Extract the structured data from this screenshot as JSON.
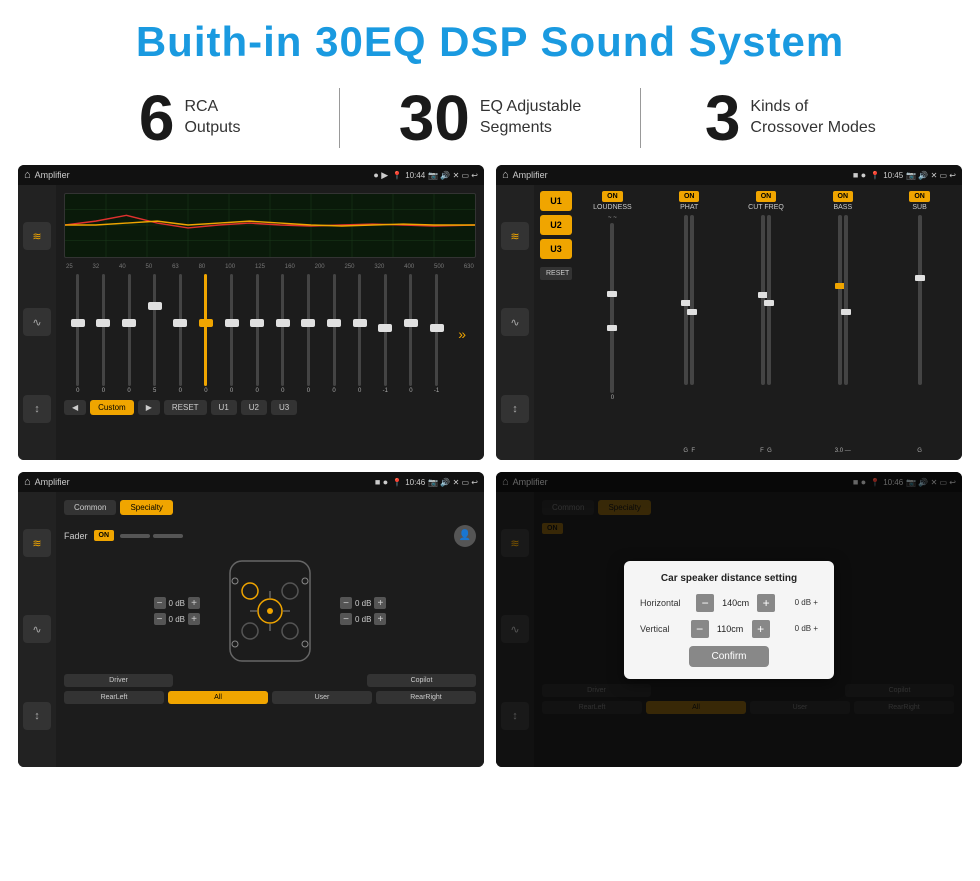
{
  "page": {
    "title": "Buith-in 30EQ DSP Sound System",
    "stats": [
      {
        "number": "6",
        "label_line1": "RCA",
        "label_line2": "Outputs"
      },
      {
        "number": "30",
        "label_line1": "EQ Adjustable",
        "label_line2": "Segments"
      },
      {
        "number": "3",
        "label_line1": "Kinds of",
        "label_line2": "Crossover Modes"
      }
    ]
  },
  "screen_top_left": {
    "title": "Amplifier",
    "time": "10:44",
    "eq_freqs": [
      "25",
      "32",
      "40",
      "50",
      "63",
      "80",
      "100",
      "125",
      "160",
      "200",
      "250",
      "320",
      "400",
      "500",
      "630"
    ],
    "eq_values": [
      "0",
      "0",
      "0",
      "5",
      "0",
      "0",
      "0",
      "0",
      "0",
      "0",
      "0",
      "0",
      "-1",
      "0",
      "-1"
    ],
    "buttons": [
      "Custom",
      "RESET",
      "U1",
      "U2",
      "U3"
    ]
  },
  "screen_top_right": {
    "title": "Amplifier",
    "time": "10:45",
    "presets": [
      "U1",
      "U2",
      "U3"
    ],
    "channels": [
      {
        "on": true,
        "label": "LOUDNESS"
      },
      {
        "on": true,
        "label": "PHAT"
      },
      {
        "on": true,
        "label": "CUT FREQ"
      },
      {
        "on": true,
        "label": "BASS"
      },
      {
        "on": true,
        "label": "SUB"
      }
    ],
    "reset_label": "RESET"
  },
  "screen_bottom_left": {
    "title": "Amplifier",
    "time": "10:46",
    "tabs": [
      "Common",
      "Specialty"
    ],
    "fader_label": "Fader",
    "fader_on": "ON",
    "db_values": [
      "0 dB",
      "0 dB",
      "0 dB",
      "0 dB"
    ],
    "bottom_buttons": [
      "Driver",
      "Copilot",
      "RearLeft",
      "All",
      "User",
      "RearRight"
    ]
  },
  "screen_bottom_right": {
    "title": "Amplifier",
    "time": "10:46",
    "tabs": [
      "Common",
      "Specialty"
    ],
    "fader_on": "ON",
    "dialog": {
      "title": "Car speaker distance setting",
      "horizontal_label": "Horizontal",
      "horizontal_value": "140cm",
      "vertical_label": "Vertical",
      "vertical_value": "110cm",
      "confirm_label": "Confirm"
    },
    "bottom_buttons": [
      "Driver",
      "Copilot",
      "RearLeft",
      "All",
      "User",
      "RearRight"
    ]
  },
  "icons": {
    "home": "⌂",
    "play": "▶",
    "back": "◀",
    "pause": "⏸",
    "settings": "⚙",
    "eq": "≋",
    "speaker": "♪",
    "arrows": "↕",
    "location": "📍",
    "camera": "📷",
    "volume": "🔊",
    "close": "✕",
    "window": "▭",
    "return": "↩",
    "minus": "−",
    "plus": "+"
  }
}
